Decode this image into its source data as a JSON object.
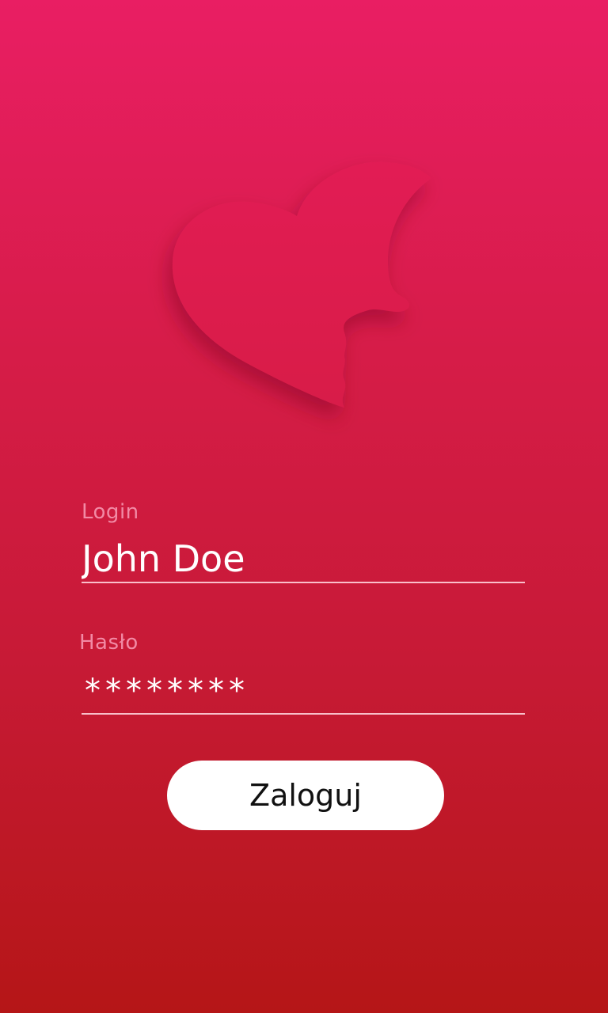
{
  "colors": {
    "background_top": "#e91e63",
    "background_bottom": "#b51617",
    "field_label": "#f28aa5",
    "text": "#ffffff",
    "button_background": "#ffffff",
    "button_text": "#111111"
  },
  "logo": {
    "icon": "heart-face-icon"
  },
  "login": {
    "label": "Login",
    "value": "John Doe"
  },
  "password": {
    "label": "Hasło",
    "value": "********"
  },
  "button": {
    "label": "Zaloguj"
  }
}
